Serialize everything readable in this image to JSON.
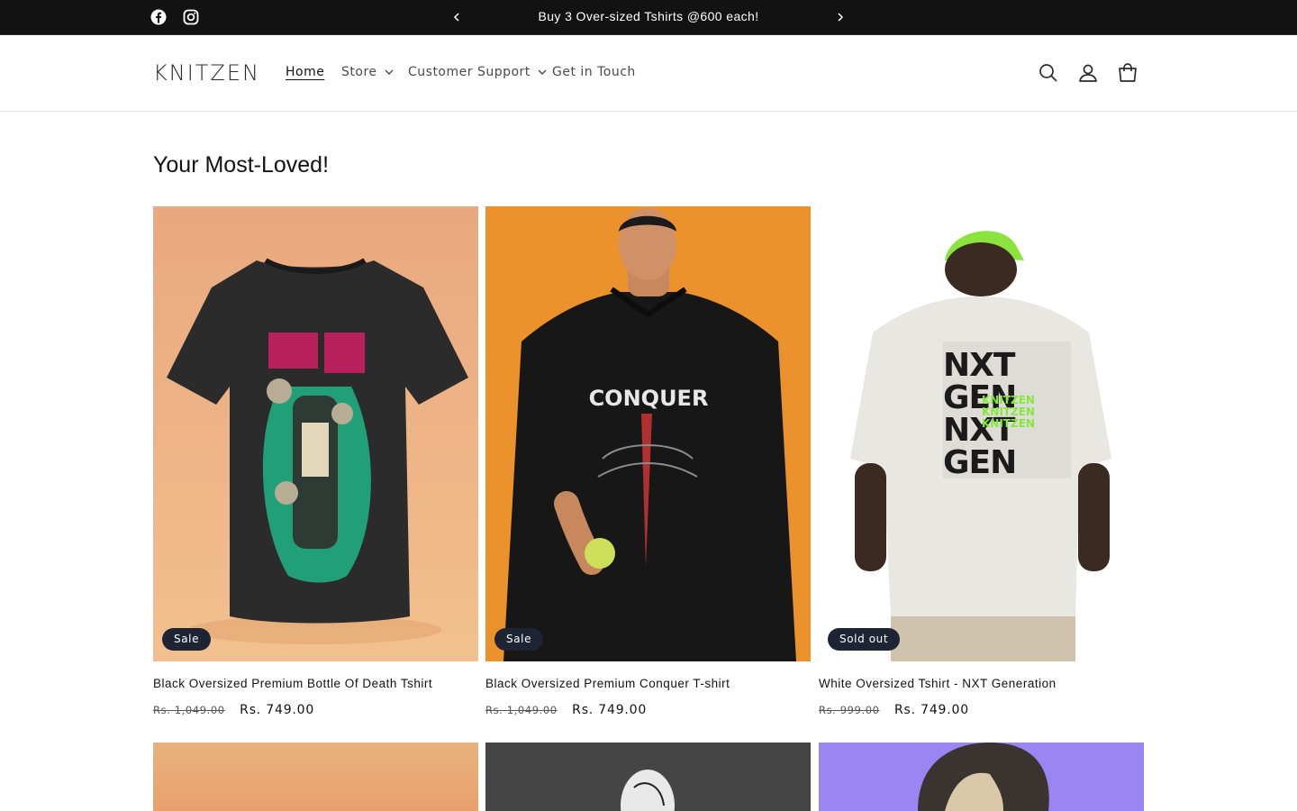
{
  "announcement": {
    "text": "Buy 3 Over-sized Tshirts @600 each!",
    "social_icons": [
      "facebook-icon",
      "instagram-icon"
    ]
  },
  "header": {
    "logo": "KNITZEN",
    "nav": [
      {
        "label": "Home",
        "active": true,
        "has_dropdown": false
      },
      {
        "label": "Store",
        "active": false,
        "has_dropdown": true
      },
      {
        "label": "Customer Support",
        "active": false,
        "has_dropdown": true
      },
      {
        "label": "Get in Touch",
        "active": false,
        "has_dropdown": false
      }
    ],
    "icons": [
      "search-icon",
      "account-icon",
      "cart-icon"
    ]
  },
  "section": {
    "title": "Your Most-Loved!",
    "products": [
      {
        "title": "Black Oversized Premium Bottle Of Death Tshirt",
        "badge": "Sale",
        "compare_price": "Rs. 1,049.00",
        "price": "Rs. 749.00"
      },
      {
        "title": "Black Oversized Premium Conquer T-shirt",
        "badge": "Sale",
        "compare_price": "Rs. 1,049.00",
        "price": "Rs. 749.00"
      },
      {
        "title": "White Oversized Tshirt - NXT Generation",
        "badge": "Sold out",
        "compare_price": "Rs. 999.00",
        "price": "Rs. 749.00"
      }
    ],
    "shirt_prints": {
      "conquer_text": "CONQUER",
      "nxt_lines": [
        "NXT",
        "GEN",
        "NXT",
        "GEN"
      ],
      "knitzen_lines": [
        "KNITZEN",
        "KNITZEN",
        "KNITZEN"
      ]
    }
  },
  "colors": {
    "announcement_bg": "#121212",
    "badge_bg": "#1e2433",
    "accent_green": "#86e83a",
    "accent_pink": "#d8245a"
  }
}
